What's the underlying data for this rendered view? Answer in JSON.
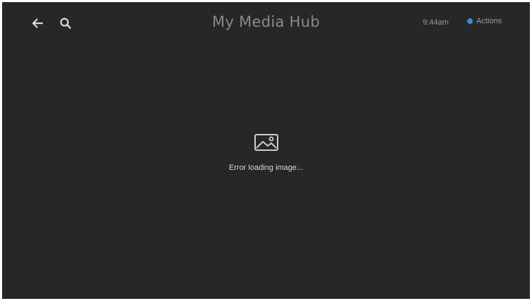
{
  "header": {
    "title": "My Media Hub",
    "back_icon": "arrow-left-icon",
    "search_icon": "search-icon",
    "time": "9:44am",
    "actions_label": "Actions",
    "actions_dot_color": "#3a86e0"
  },
  "main": {
    "placeholder_icon": "image-icon",
    "error_message": "Error loading image..."
  },
  "colors": {
    "background": "#272727",
    "title": "#8a8a8a",
    "text": "#d8d8d8"
  }
}
